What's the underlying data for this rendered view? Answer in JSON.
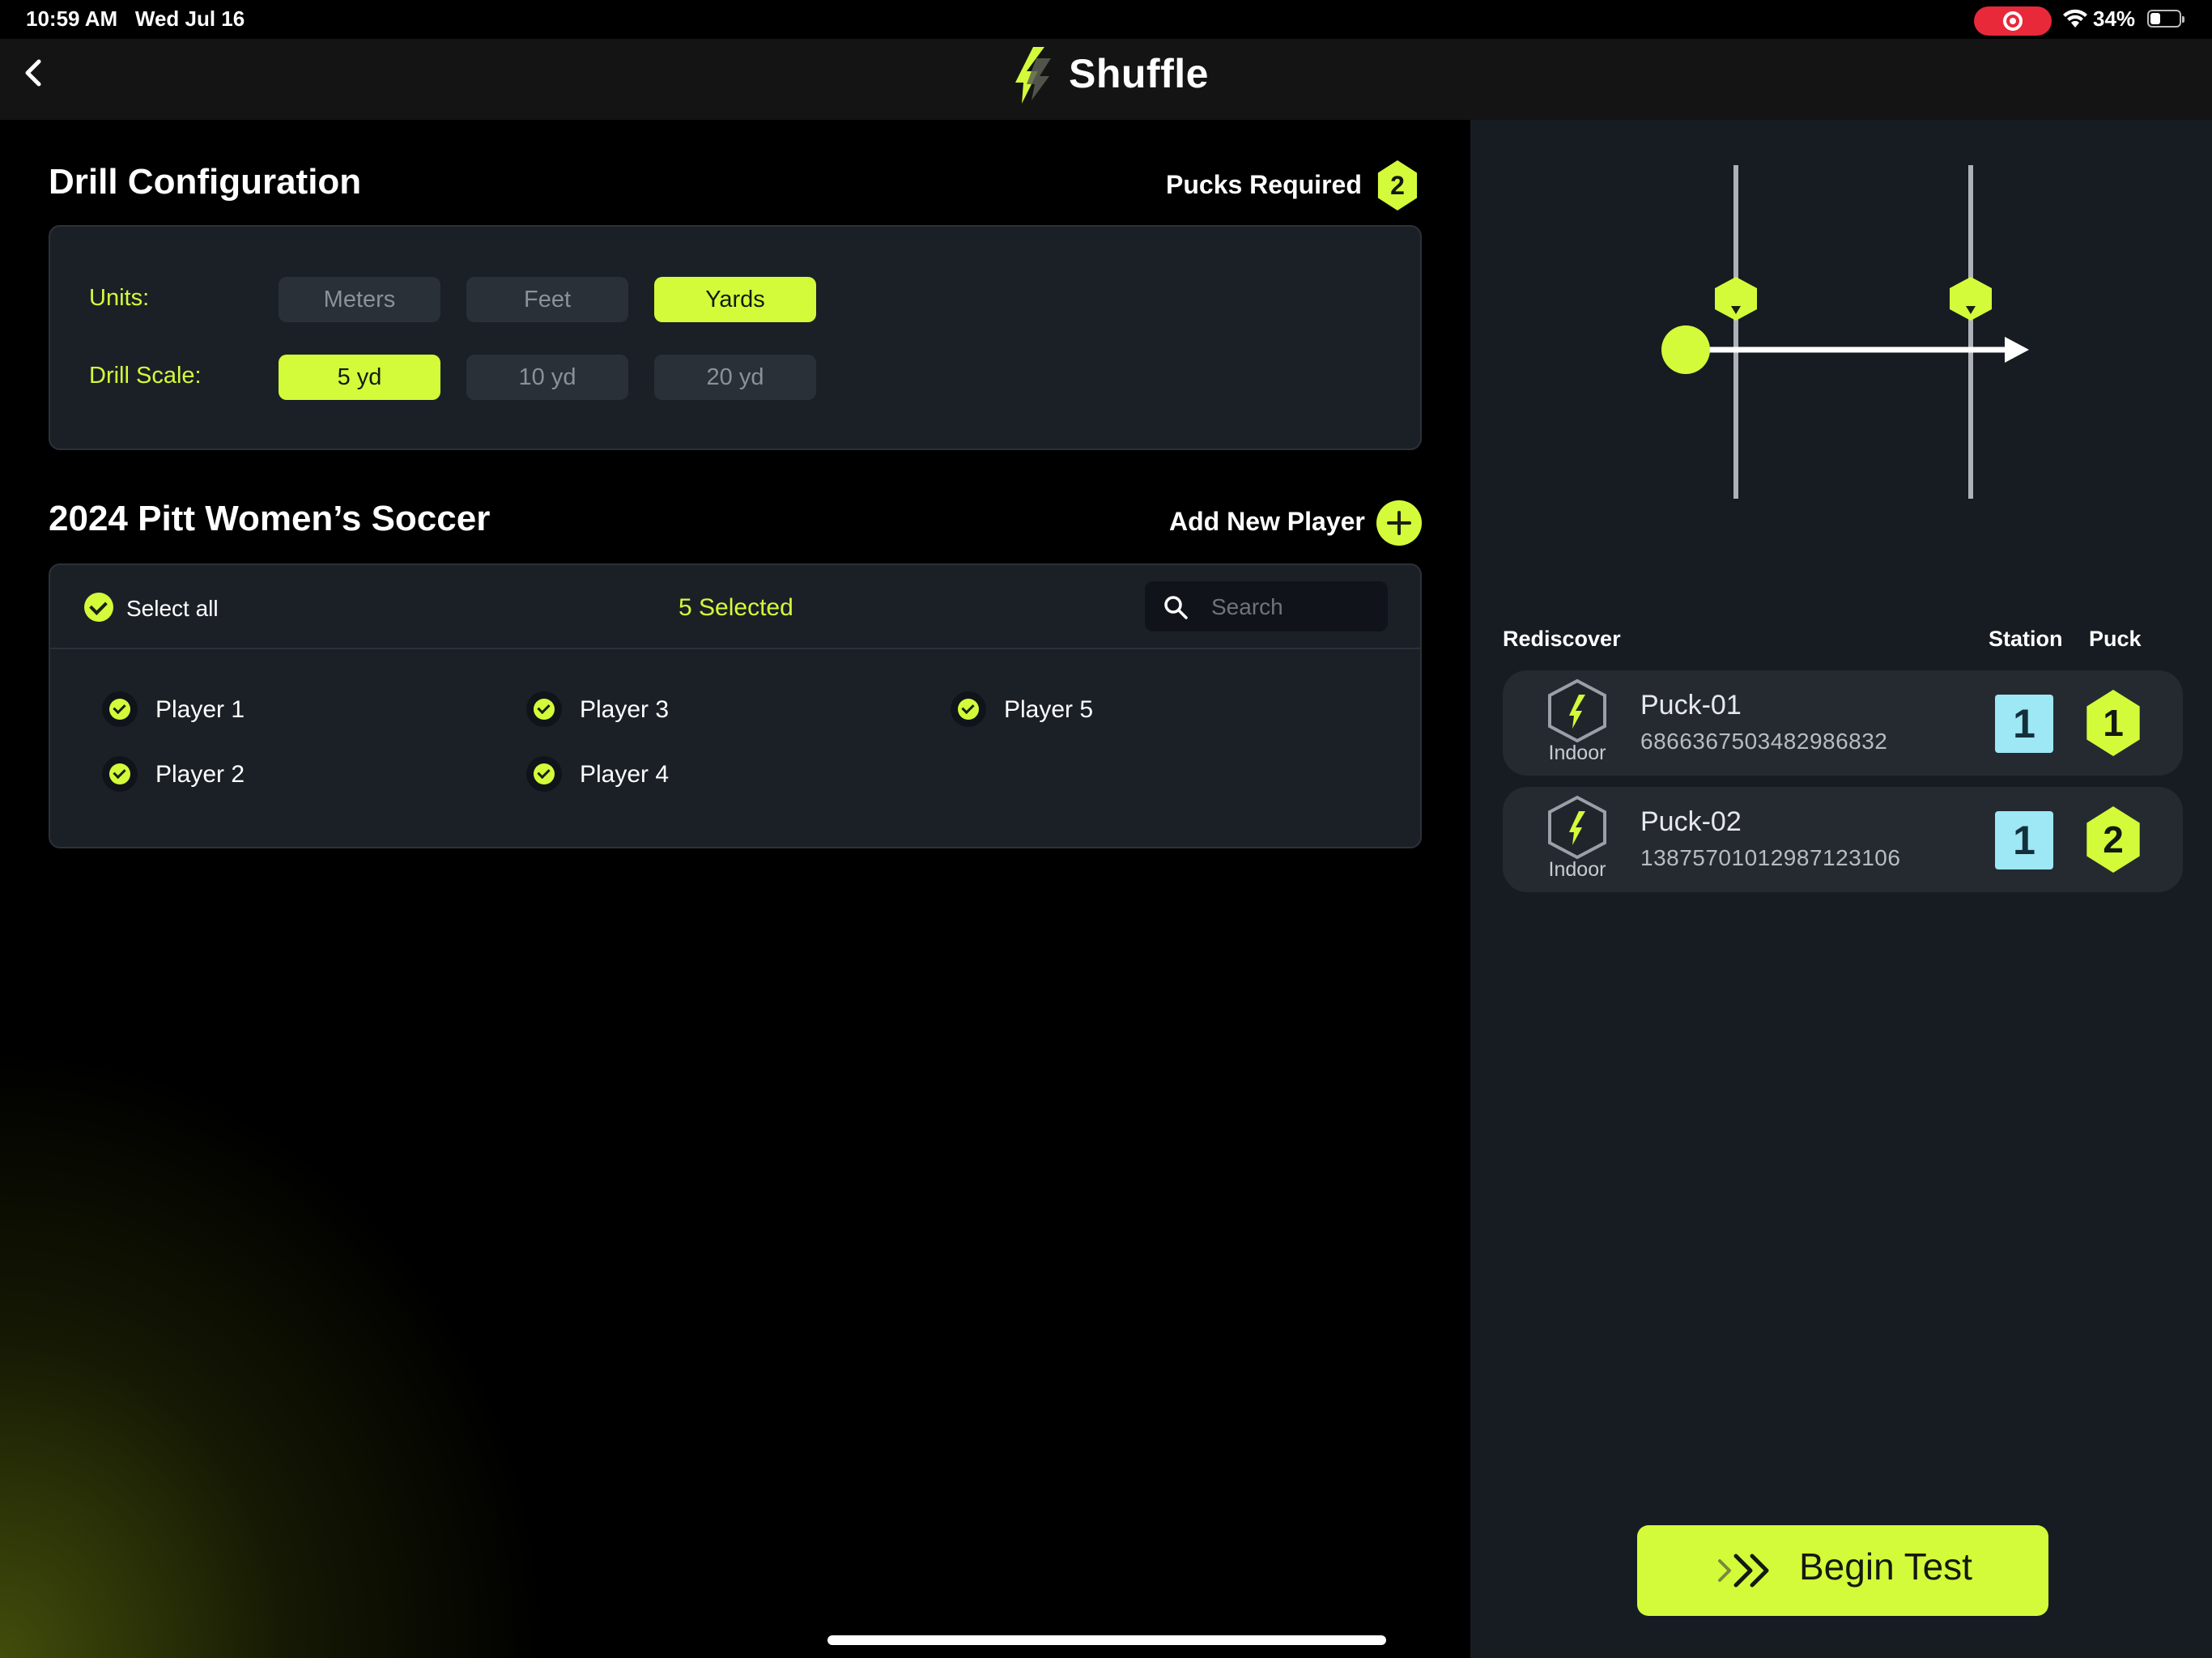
{
  "status_bar": {
    "time": "10:59 AM",
    "date": "Wed Jul 16",
    "battery_percent": "34%",
    "battery_level": 0.34,
    "screen_recording": true
  },
  "nav": {
    "title": "Shuffle",
    "back_icon": "chevron-left-icon",
    "logo_icon": "shuffle-bolt-logo"
  },
  "drill_config": {
    "title": "Drill Configuration",
    "pucks_required_label": "Pucks Required",
    "pucks_required_count": "2",
    "units_label": "Units:",
    "units_options": [
      "Meters",
      "Feet",
      "Yards"
    ],
    "units_selected": "Yards",
    "scale_label": "Drill Scale:",
    "scale_options": [
      "5 yd",
      "10 yd",
      "20 yd"
    ],
    "scale_selected": "5 yd"
  },
  "roster": {
    "title": "2024 Pitt Women’s Soccer",
    "add_player_label": "Add New Player",
    "select_all_label": "Select all",
    "selected_count_label": "5 Selected",
    "search_placeholder": "Search",
    "players": [
      {
        "name": "Player 1",
        "selected": true
      },
      {
        "name": "Player 2",
        "selected": true
      },
      {
        "name": "Player 3",
        "selected": true
      },
      {
        "name": "Player 4",
        "selected": true
      },
      {
        "name": "Player 5",
        "selected": true
      }
    ]
  },
  "pucks_panel": {
    "rediscover_label": "Rediscover",
    "station_header": "Station",
    "puck_header": "Puck",
    "pucks": [
      {
        "name": "Puck-01",
        "id": "6866367503482986832",
        "environment": "Indoor",
        "station": "1",
        "puck_number": "1"
      },
      {
        "name": "Puck-02",
        "id": "13875701012987123106",
        "environment": "Indoor",
        "station": "1",
        "puck_number": "2"
      }
    ]
  },
  "begin_test_label": "Begin Test",
  "colors": {
    "accent": "#d4fb3a",
    "station": "#9ee7f5",
    "panel": "#1b2027",
    "right_pane": "#171c22",
    "recording": "#e8293a"
  }
}
